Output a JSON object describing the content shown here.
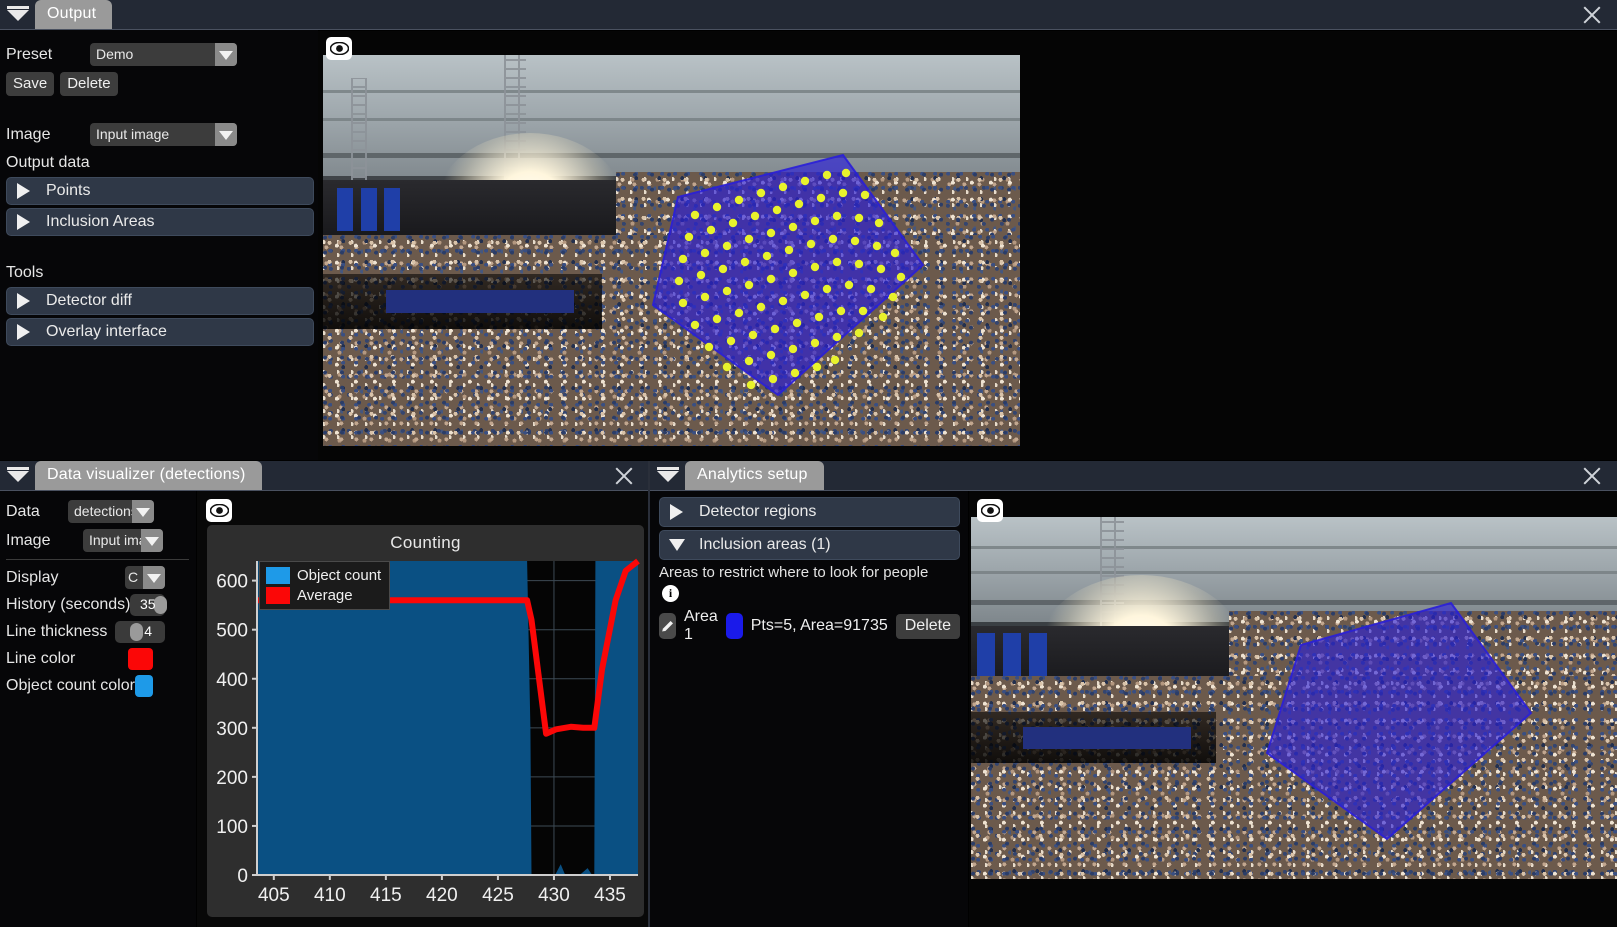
{
  "top_panel": {
    "tab_label": "Output",
    "close_icon": "close-icon",
    "collapse_icon": "collapse-triangle-icon",
    "preset": {
      "label": "Preset",
      "value": "Demo",
      "options": [
        "Demo"
      ],
      "save_label": "Save",
      "delete_label": "Delete"
    },
    "image": {
      "label": "Image",
      "value": "Input image",
      "options": [
        "Input image"
      ]
    },
    "output_data": {
      "label": "Output data",
      "items": [
        {
          "label": "Points",
          "expanded": false
        },
        {
          "label": "Inclusion Areas",
          "expanded": false
        }
      ]
    },
    "tools": {
      "label": "Tools",
      "items": [
        {
          "label": "Detector diff",
          "expanded": false
        },
        {
          "label": "Overlay interface",
          "expanded": false
        }
      ]
    },
    "viewer": {
      "eye_icon": "eye-visibility-icon"
    }
  },
  "data_visualizer": {
    "tab_label": "Data visualizer (detections)",
    "close_icon": "close-icon",
    "collapse_icon": "collapse-triangle-icon",
    "controls": {
      "data_label": "Data",
      "data_value": "detections",
      "image_label": "Image",
      "image_value": "Input image",
      "display_label": "Display",
      "display_value": "C",
      "history_label": "History (seconds)",
      "history_value": "35",
      "line_thickness_label": "Line thickness",
      "line_thickness_value": "4",
      "line_color_label": "Line color",
      "line_color_value": "#fb0707",
      "object_count_color_label": "Object count color",
      "object_count_color_value": "#1e9ae8"
    },
    "viewer": {
      "eye_icon": "eye-visibility-icon"
    }
  },
  "chart_data": {
    "type": "area",
    "title": "Counting",
    "xlabel": "",
    "ylabel": "",
    "xlim": [
      403.5,
      437.5
    ],
    "ylim": [
      0,
      640
    ],
    "xticks": [
      405,
      410,
      415,
      420,
      425,
      430,
      435
    ],
    "yticks": [
      0,
      100,
      200,
      300,
      400,
      500,
      600
    ],
    "grid": true,
    "legend_position": "top-left",
    "series": [
      {
        "name": "Object count",
        "color": "#1e9ae8",
        "fill_color": "#0a5083",
        "style": "area",
        "x": [
          403.6,
          424.0,
          427.6,
          427.9,
          428.0,
          428.6,
          429.4,
          430.1,
          430.6,
          431.0,
          431.6,
          432.3,
          433.0,
          433.4,
          433.6,
          433.7,
          434.1,
          437.5
        ],
        "y": [
          640,
          640,
          640,
          300,
          0,
          0,
          0,
          0,
          22,
          0,
          0,
          0,
          14,
          0,
          0,
          640,
          640,
          640
        ]
      },
      {
        "name": "Average",
        "color": "#fb0707",
        "style": "line",
        "x": [
          403.6,
          427.6,
          428.0,
          429.3,
          430.2,
          431.5,
          432.6,
          433.4,
          433.6,
          434.3,
          435.5,
          436.4,
          437.5
        ],
        "y": [
          560,
          560,
          520,
          288,
          297,
          302,
          300,
          300,
          300,
          420,
          560,
          620,
          640
        ]
      }
    ]
  },
  "analytics_setup": {
    "tab_label": "Analytics setup",
    "close_icon": "close-icon",
    "collapse_icon": "collapse-triangle-icon",
    "sections": [
      {
        "label": "Detector regions",
        "expanded": false
      },
      {
        "label": "Inclusion areas (1)",
        "expanded": true
      }
    ],
    "description": "Areas to restrict where to look for people",
    "info_icon": "info-icon",
    "areas": [
      {
        "edit_icon": "pencil-edit-icon",
        "name": "Area 1",
        "color": "#1a1aea",
        "stats": "Pts=5, Area=91735",
        "delete_label": "Delete"
      }
    ],
    "viewer": {
      "eye_icon": "eye-visibility-icon"
    }
  }
}
